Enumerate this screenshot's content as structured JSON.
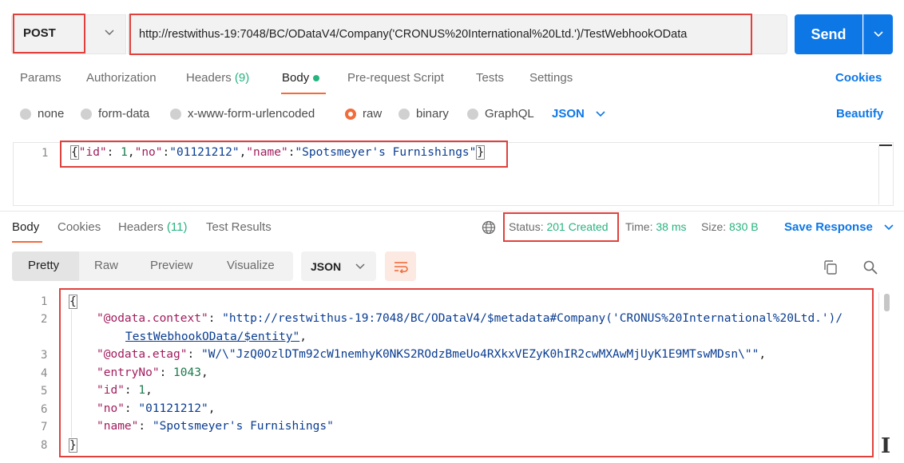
{
  "request": {
    "method": "POST",
    "url": "http://restwithus-19:7048/BC/ODataV4/Company('CRONUS%20International%20Ltd.')/TestWebhookOData",
    "send_label": "Send"
  },
  "request_tabs": [
    {
      "label": "Params"
    },
    {
      "label": "Authorization"
    },
    {
      "label": "Headers",
      "count": "(9)"
    },
    {
      "label": "Body"
    },
    {
      "label": "Pre-request Script"
    },
    {
      "label": "Tests"
    },
    {
      "label": "Settings"
    }
  ],
  "cookies_label": "Cookies",
  "body_types": [
    {
      "label": "none"
    },
    {
      "label": "form-data"
    },
    {
      "label": "x-www-form-urlencoded"
    },
    {
      "label": "raw",
      "selected": true
    },
    {
      "label": "binary"
    },
    {
      "label": "GraphQL"
    }
  ],
  "body_format": "JSON",
  "beautify_label": "Beautify",
  "request_body": {
    "line": "1",
    "parts": [
      "{",
      "\"id\"",
      ": ",
      "1",
      ",",
      "\"no\"",
      ":",
      "\"01121212\"",
      ",",
      "\"name\"",
      ":",
      "\"Spotsmeyer's Furnishings\"",
      "}"
    ]
  },
  "response_tabs": [
    {
      "label": "Body"
    },
    {
      "label": "Cookies"
    },
    {
      "label": "Headers",
      "count": "(11)"
    },
    {
      "label": "Test Results"
    }
  ],
  "status": {
    "label": "Status:",
    "value": "201 Created"
  },
  "time": {
    "label": "Time:",
    "value": "38 ms"
  },
  "size": {
    "label": "Size:",
    "value": "830 B"
  },
  "save_response_label": "Save Response",
  "view_modes": [
    "Pretty",
    "Raw",
    "Preview",
    "Visualize"
  ],
  "response_format": "JSON",
  "response_body": {
    "line_numbers": [
      "1",
      "2",
      "3",
      "4",
      "5",
      "6",
      "7",
      "8"
    ],
    "open_brace": "{",
    "close_brace": "}",
    "context_key": "\"@odata.context\"",
    "context_val_1": "\"http://restwithus-19:7048/BC/ODataV4/$metadata#Company('CRONUS%20International%20Ltd.')/",
    "context_val_2": "TestWebhookOData/$entity\"",
    "etag_key": "\"@odata.etag\"",
    "etag_val": "\"W/\\\"JzQ0OzlDTm92cW1nemhyK0NKS2ROdzBmeUo4RXkxVEZyK0hIR2cwMXAwMjUyK1E9MTswMDsn\\\"\"",
    "entry_key": "\"entryNo\"",
    "entry_val": "1043",
    "id_key": "\"id\"",
    "id_val": "1",
    "no_key": "\"no\"",
    "no_val": "\"01121212\"",
    "name_key": "\"name\"",
    "name_val": "\"Spotsmeyer's Furnishings\""
  }
}
